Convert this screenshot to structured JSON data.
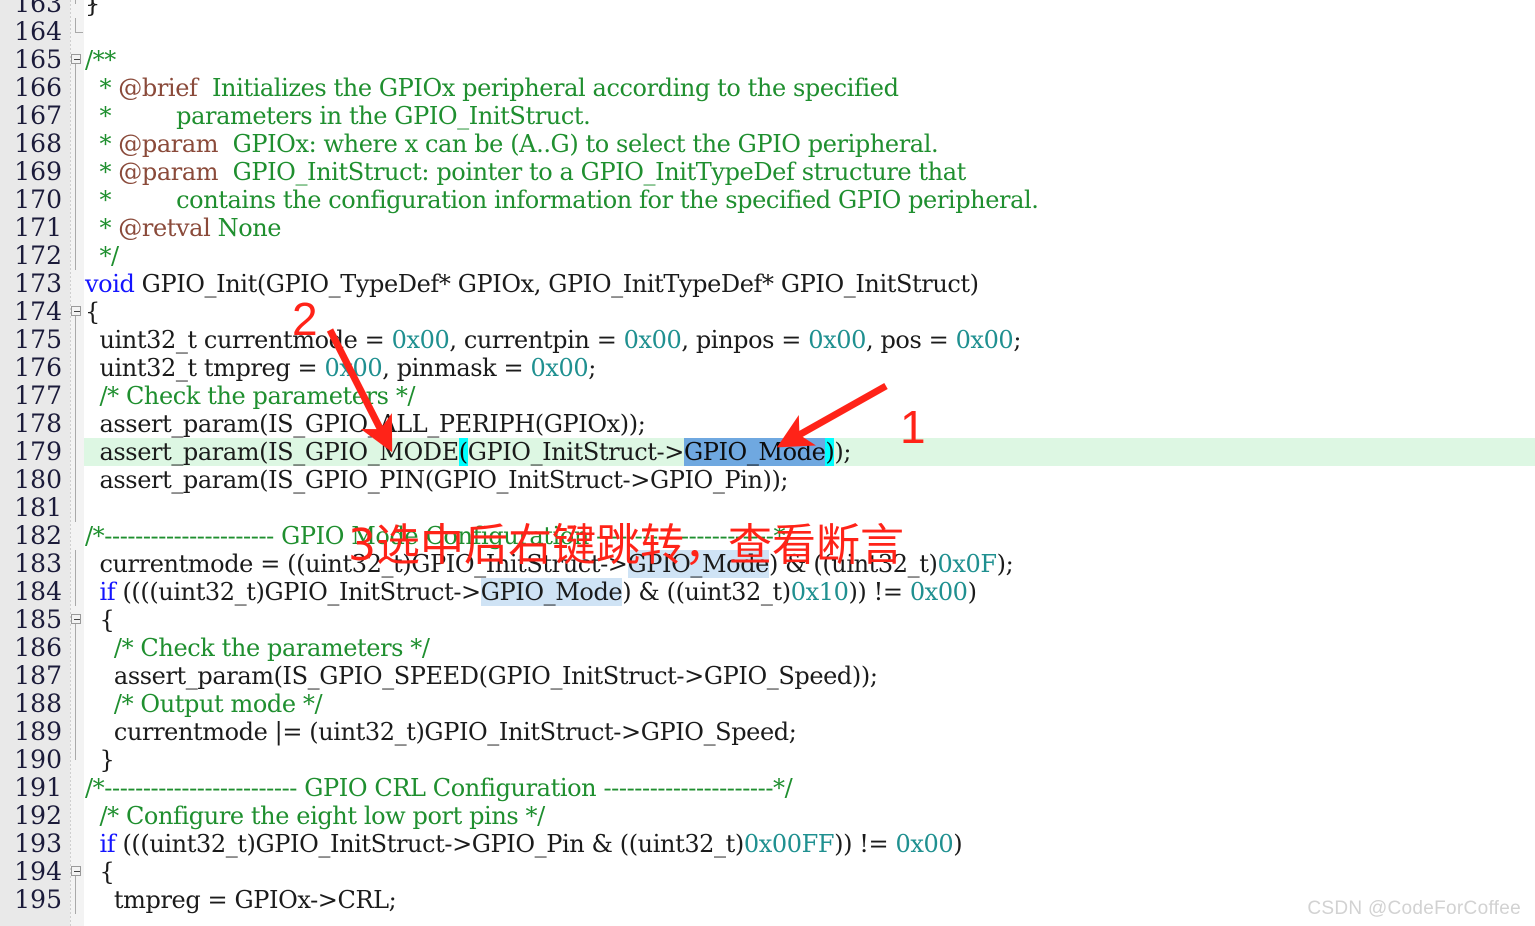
{
  "editor": {
    "app_kind": "keil-uvision-c-source-editor",
    "file_language": "C",
    "colors": {
      "background": "#ffffff",
      "gutter_background": "#e9e9e9",
      "fold_column_background": "#f3f3f3",
      "line_number_text": "#1b1b3a",
      "default_text": "#1b1b1b",
      "keyword": "#1414ff",
      "comment": "#1f8f2f",
      "doc_tag": "#8a4a3a",
      "number": "#1f9090",
      "current_line_highlight": "#ddf7e3",
      "selection": "#6fa8e0",
      "occurrence_highlight": "#cfe3f5",
      "matching_paren": "#00ffff",
      "annotation_red": "#ff2318",
      "watermark_text": "#d2d2d2"
    },
    "current_line_number": "179",
    "selected_text": "GPIO_Mode",
    "partial_top_line": "}"
  },
  "lines": [
    {
      "n": "163",
      "fold": "end",
      "segments": [
        {
          "t": "}",
          "c": "pn"
        }
      ]
    },
    {
      "n": "164",
      "fold": "cap",
      "segments": [
        {
          "t": "",
          "c": "pn"
        }
      ]
    },
    {
      "n": "165",
      "fold": "open",
      "segments": [
        {
          "t": "/**",
          "c": "cm"
        }
      ]
    },
    {
      "n": "166",
      "fold": "line",
      "segments": [
        {
          "t": "  * ",
          "c": "cm"
        },
        {
          "t": "@brief",
          "c": "tag"
        },
        {
          "t": "  Initializes the GPIOx peripheral according to the specified",
          "c": "cm"
        }
      ]
    },
    {
      "n": "167",
      "fold": "line",
      "segments": [
        {
          "t": "  *         parameters in the GPIO_InitStruct.",
          "c": "cm"
        }
      ]
    },
    {
      "n": "168",
      "fold": "line",
      "segments": [
        {
          "t": "  * ",
          "c": "cm"
        },
        {
          "t": "@param",
          "c": "tag"
        },
        {
          "t": "  GPIOx: where x can be (A..G) to select the GPIO peripheral.",
          "c": "cm"
        }
      ]
    },
    {
      "n": "169",
      "fold": "line",
      "segments": [
        {
          "t": "  * ",
          "c": "cm"
        },
        {
          "t": "@param",
          "c": "tag"
        },
        {
          "t": "  GPIO_InitStruct: pointer to a GPIO_InitTypeDef structure that",
          "c": "cm"
        }
      ]
    },
    {
      "n": "170",
      "fold": "line",
      "segments": [
        {
          "t": "  *         contains the configuration information for the specified GPIO peripheral.",
          "c": "cm"
        }
      ]
    },
    {
      "n": "171",
      "fold": "line",
      "segments": [
        {
          "t": "  * ",
          "c": "cm"
        },
        {
          "t": "@retval",
          "c": "tag"
        },
        {
          "t": " None",
          "c": "cm"
        }
      ]
    },
    {
      "n": "172",
      "fold": "line",
      "segments": [
        {
          "t": "  */",
          "c": "cm"
        }
      ]
    },
    {
      "n": "173",
      "fold": "none",
      "segments": [
        {
          "t": "void",
          "c": "kw"
        },
        {
          "t": " GPIO_Init(GPIO_TypeDef* GPIOx, GPIO_InitTypeDef* GPIO_InitStruct)",
          "c": "pn"
        }
      ]
    },
    {
      "n": "174",
      "fold": "open",
      "segments": [
        {
          "t": "{",
          "c": "pn"
        }
      ]
    },
    {
      "n": "175",
      "fold": "line",
      "segments": [
        {
          "t": "  uint32_t currentmode = ",
          "c": "pn"
        },
        {
          "t": "0x00",
          "c": "num"
        },
        {
          "t": ", currentpin = ",
          "c": "pn"
        },
        {
          "t": "0x00",
          "c": "num"
        },
        {
          "t": ", pinpos = ",
          "c": "pn"
        },
        {
          "t": "0x00",
          "c": "num"
        },
        {
          "t": ", pos = ",
          "c": "pn"
        },
        {
          "t": "0x00",
          "c": "num"
        },
        {
          "t": ";",
          "c": "pn"
        }
      ]
    },
    {
      "n": "176",
      "fold": "line",
      "segments": [
        {
          "t": "  uint32_t tmpreg = ",
          "c": "pn"
        },
        {
          "t": "0x00",
          "c": "num"
        },
        {
          "t": ", pinmask = ",
          "c": "pn"
        },
        {
          "t": "0x00",
          "c": "num"
        },
        {
          "t": ";",
          "c": "pn"
        }
      ]
    },
    {
      "n": "177",
      "fold": "line",
      "segments": [
        {
          "t": "  /* Check the parameters */",
          "c": "cm"
        }
      ]
    },
    {
      "n": "178",
      "fold": "line",
      "segments": [
        {
          "t": "  assert_param(IS_GPIO_ALL_PERIPH(GPIOx));",
          "c": "pn"
        }
      ]
    },
    {
      "n": "179",
      "fold": "line",
      "current": true,
      "segments": [
        {
          "t": "  assert_param(IS_GPIO_MODE",
          "c": "pn"
        },
        {
          "t": "(",
          "c": "paren"
        },
        {
          "t": "GPIO_InitStruct->",
          "c": "pn"
        },
        {
          "t": "GPIO_Mode",
          "c": "sel"
        },
        {
          "t": ")",
          "c": "paren"
        },
        {
          "t": ");",
          "c": "pn"
        }
      ]
    },
    {
      "n": "180",
      "fold": "line",
      "segments": [
        {
          "t": "  assert_param(IS_GPIO_PIN(GPIO_InitStruct->GPIO_Pin));",
          "c": "pn"
        }
      ]
    },
    {
      "n": "181",
      "fold": "line",
      "segments": [
        {
          "t": "",
          "c": "pn"
        }
      ]
    },
    {
      "n": "182",
      "fold": "none",
      "segments": [
        {
          "t": "/*---------------------- GPIO Mode Configuration -----------------------*/",
          "c": "cm"
        }
      ]
    },
    {
      "n": "183",
      "fold": "line",
      "segments": [
        {
          "t": "  currentmode = ((uint32_t)GPIO_InitStruct->",
          "c": "pn"
        },
        {
          "t": "GPIO_Mode",
          "c": "occ"
        },
        {
          "t": ") & ((uint32_t)",
          "c": "pn"
        },
        {
          "t": "0x0F",
          "c": "num"
        },
        {
          "t": ");",
          "c": "pn"
        }
      ]
    },
    {
      "n": "184",
      "fold": "line",
      "segments": [
        {
          "t": "  if",
          "c": "kw"
        },
        {
          "t": " ((((uint32_t)GPIO_InitStruct->",
          "c": "pn"
        },
        {
          "t": "GPIO_Mode",
          "c": "occ"
        },
        {
          "t": ") & ((uint32_t)",
          "c": "pn"
        },
        {
          "t": "0x10",
          "c": "num"
        },
        {
          "t": ")) != ",
          "c": "pn"
        },
        {
          "t": "0x00",
          "c": "num"
        },
        {
          "t": ")",
          "c": "pn"
        }
      ]
    },
    {
      "n": "185",
      "fold": "open",
      "segments": [
        {
          "t": "  {",
          "c": "pn"
        }
      ]
    },
    {
      "n": "186",
      "fold": "line",
      "segments": [
        {
          "t": "    /* Check the parameters */",
          "c": "cm"
        }
      ]
    },
    {
      "n": "187",
      "fold": "line",
      "segments": [
        {
          "t": "    assert_param(IS_GPIO_SPEED(GPIO_InitStruct->GPIO_Speed));",
          "c": "pn"
        }
      ]
    },
    {
      "n": "188",
      "fold": "line",
      "segments": [
        {
          "t": "    /* Output mode */",
          "c": "cm"
        }
      ]
    },
    {
      "n": "189",
      "fold": "line",
      "segments": [
        {
          "t": "    currentmode |= (uint32_t)GPIO_InitStruct->GPIO_Speed;",
          "c": "pn"
        }
      ]
    },
    {
      "n": "190",
      "fold": "end",
      "segments": [
        {
          "t": "  }",
          "c": "pn"
        }
      ]
    },
    {
      "n": "191",
      "fold": "none",
      "segments": [
        {
          "t": "/*------------------------- GPIO CRL Configuration ----------------------*/",
          "c": "cm"
        }
      ]
    },
    {
      "n": "192",
      "fold": "none",
      "segments": [
        {
          "t": "  /* Configure the eight low port pins */",
          "c": "cm"
        }
      ]
    },
    {
      "n": "193",
      "fold": "none",
      "segments": [
        {
          "t": "  if",
          "c": "kw"
        },
        {
          "t": " (((uint32_t)GPIO_InitStruct->GPIO_Pin & ((uint32_t)",
          "c": "pn"
        },
        {
          "t": "0x00FF",
          "c": "num"
        },
        {
          "t": ")) != ",
          "c": "pn"
        },
        {
          "t": "0x00",
          "c": "num"
        },
        {
          "t": ")",
          "c": "pn"
        }
      ]
    },
    {
      "n": "194",
      "fold": "open",
      "segments": [
        {
          "t": "  {",
          "c": "pn"
        }
      ]
    },
    {
      "n": "195",
      "fold": "line",
      "segments": [
        {
          "t": "    tmpreg = GPIOx->CRL;",
          "c": "pn"
        }
      ]
    }
  ],
  "annotations": {
    "marker_1": "1",
    "marker_2": "2",
    "chinese_note": "3选中后右键跳转，查看断言"
  },
  "watermark": {
    "text": "CSDN @CodeForCoffee"
  }
}
